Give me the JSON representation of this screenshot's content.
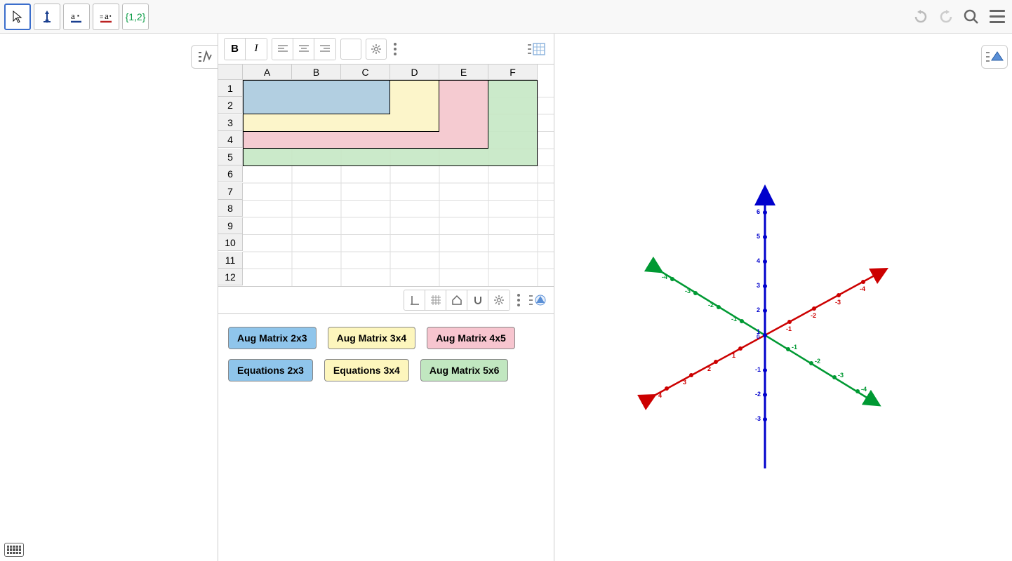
{
  "toolbar": {
    "list_label": "{1,2}"
  },
  "spreadsheet": {
    "columns": [
      "A",
      "B",
      "C",
      "D",
      "E",
      "F"
    ],
    "rows": [
      "1",
      "2",
      "3",
      "4",
      "5",
      "6",
      "7",
      "8",
      "9",
      "10",
      "11",
      "12"
    ]
  },
  "matrix_buttons": {
    "row1": [
      {
        "label": "Aug Matrix 2x3",
        "color": "blue"
      },
      {
        "label": "Aug Matrix 3x4",
        "color": "yellow"
      },
      {
        "label": "Aug Matrix 4x5",
        "color": "pink"
      }
    ],
    "row2": [
      {
        "label": "Equations  2x3",
        "color": "blue"
      },
      {
        "label": "Equations  3x4",
        "color": "yellow"
      },
      {
        "label": "Aug Matrix 5x6",
        "color": "green"
      }
    ]
  },
  "graph3d": {
    "z_ticks": [
      6,
      5,
      4,
      3,
      2,
      1,
      0,
      -1,
      -2,
      -3
    ],
    "x_ticks": [
      1,
      2,
      3,
      4,
      -1,
      -2,
      -3,
      -4
    ],
    "y_ticks": [
      1,
      2,
      3,
      4,
      -1,
      -2,
      -3,
      -4
    ],
    "colors": {
      "x": "#cc0000",
      "y": "#009933",
      "z": "#0000cc"
    }
  }
}
